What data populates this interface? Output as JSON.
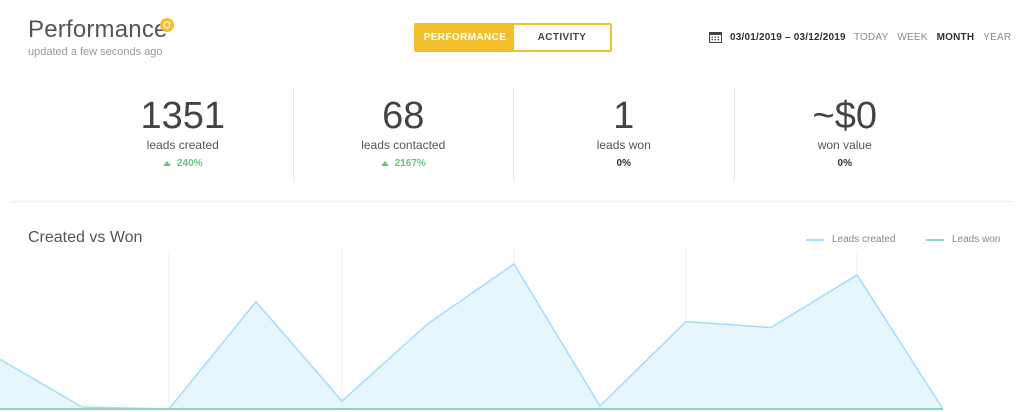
{
  "header": {
    "title": "Performance",
    "subtitle": "updated a few seconds ago",
    "tabs": [
      {
        "label": "PERFORMANCE",
        "active": true
      },
      {
        "label": "ACTIVITY",
        "active": false
      }
    ],
    "date_range": "03/01/2019 – 03/12/2019",
    "range_options": [
      {
        "label": "TODAY",
        "active": false
      },
      {
        "label": "WEEK",
        "active": false
      },
      {
        "label": "MONTH",
        "active": true
      },
      {
        "label": "YEAR",
        "active": false
      }
    ],
    "accent_color": "#f3c02d"
  },
  "stats": [
    {
      "value": "1351",
      "label": "leads created",
      "change": "240%",
      "trend": "up"
    },
    {
      "value": "68",
      "label": "leads contacted",
      "change": "2167%",
      "trend": "up"
    },
    {
      "value": "1",
      "label": "leads won",
      "change": "0%",
      "trend": "none"
    },
    {
      "value": "~$0",
      "label": "won value",
      "change": "0%",
      "trend": "none"
    }
  ],
  "chart": {
    "title": "Created vs Won",
    "legend": [
      {
        "label": "Leads created",
        "color": "#a7def7"
      },
      {
        "label": "Leads won",
        "color": "#8fd6b7"
      }
    ]
  },
  "chart_data": {
    "type": "area",
    "title": "Created vs Won",
    "x": [
      0,
      1,
      2,
      3,
      4,
      5,
      6,
      7,
      8,
      9,
      10,
      11
    ],
    "series": [
      {
        "name": "Leads created",
        "color": "#a7def7",
        "values": [
          50,
          2,
          0,
          108,
          8,
          86,
          146,
          3,
          88,
          82,
          135,
          0
        ]
      },
      {
        "name": "Leads won",
        "color": "#8fd6b7",
        "values": [
          0,
          0,
          0,
          0,
          0,
          0,
          0,
          0,
          0,
          0,
          0,
          0
        ]
      }
    ],
    "ylim": [
      0,
      150
    ],
    "grid": true,
    "legend_position": "top-right"
  }
}
